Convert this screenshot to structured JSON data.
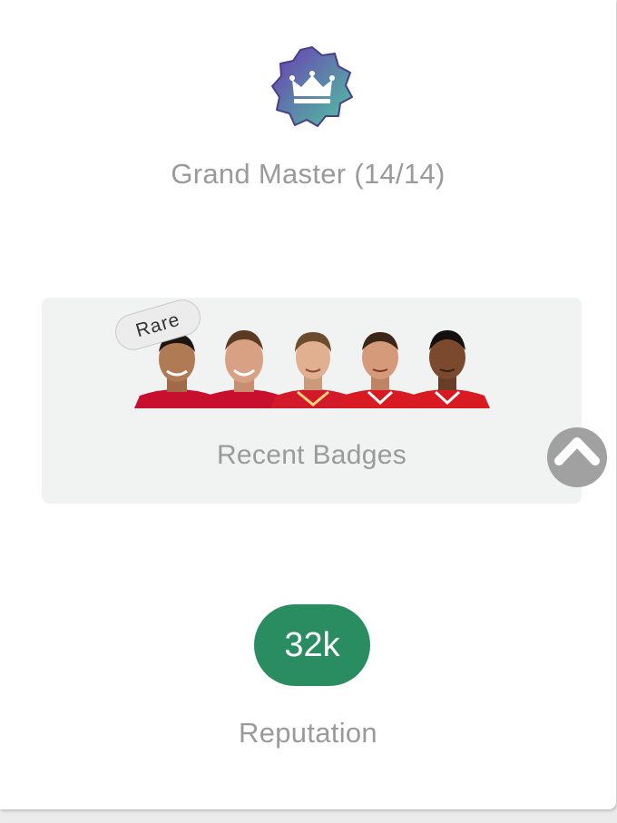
{
  "level": {
    "icon": "crown-icon",
    "label": "Grand Master (14/14)",
    "badge_gradient": [
      "#6b3bb3",
      "#4fc6a0"
    ]
  },
  "recent_badges": {
    "tag": "Rare",
    "label": "Recent Badges",
    "players": [
      {
        "icon": "player-avatar",
        "skin": "#b07a55",
        "hair": "#1c1410",
        "shirt": "#c8102e"
      },
      {
        "icon": "player-avatar",
        "skin": "#d9a183",
        "hair": "#5a3a22",
        "shirt": "#c8102e"
      },
      {
        "icon": "player-avatar",
        "skin": "#e0b091",
        "hair": "#6b4d2e",
        "shirt": "#d21a2a"
      },
      {
        "icon": "player-avatar",
        "skin": "#d49a7a",
        "hair": "#3b2618",
        "shirt": "#d81b22"
      },
      {
        "icon": "player-avatar",
        "skin": "#7b4a2e",
        "hair": "#151010",
        "shirt": "#d81b22"
      }
    ]
  },
  "scroll_button": {
    "icon": "chevron-up-icon"
  },
  "reputation": {
    "value": "32k",
    "label": "Reputation",
    "color": "#2a8d62"
  }
}
